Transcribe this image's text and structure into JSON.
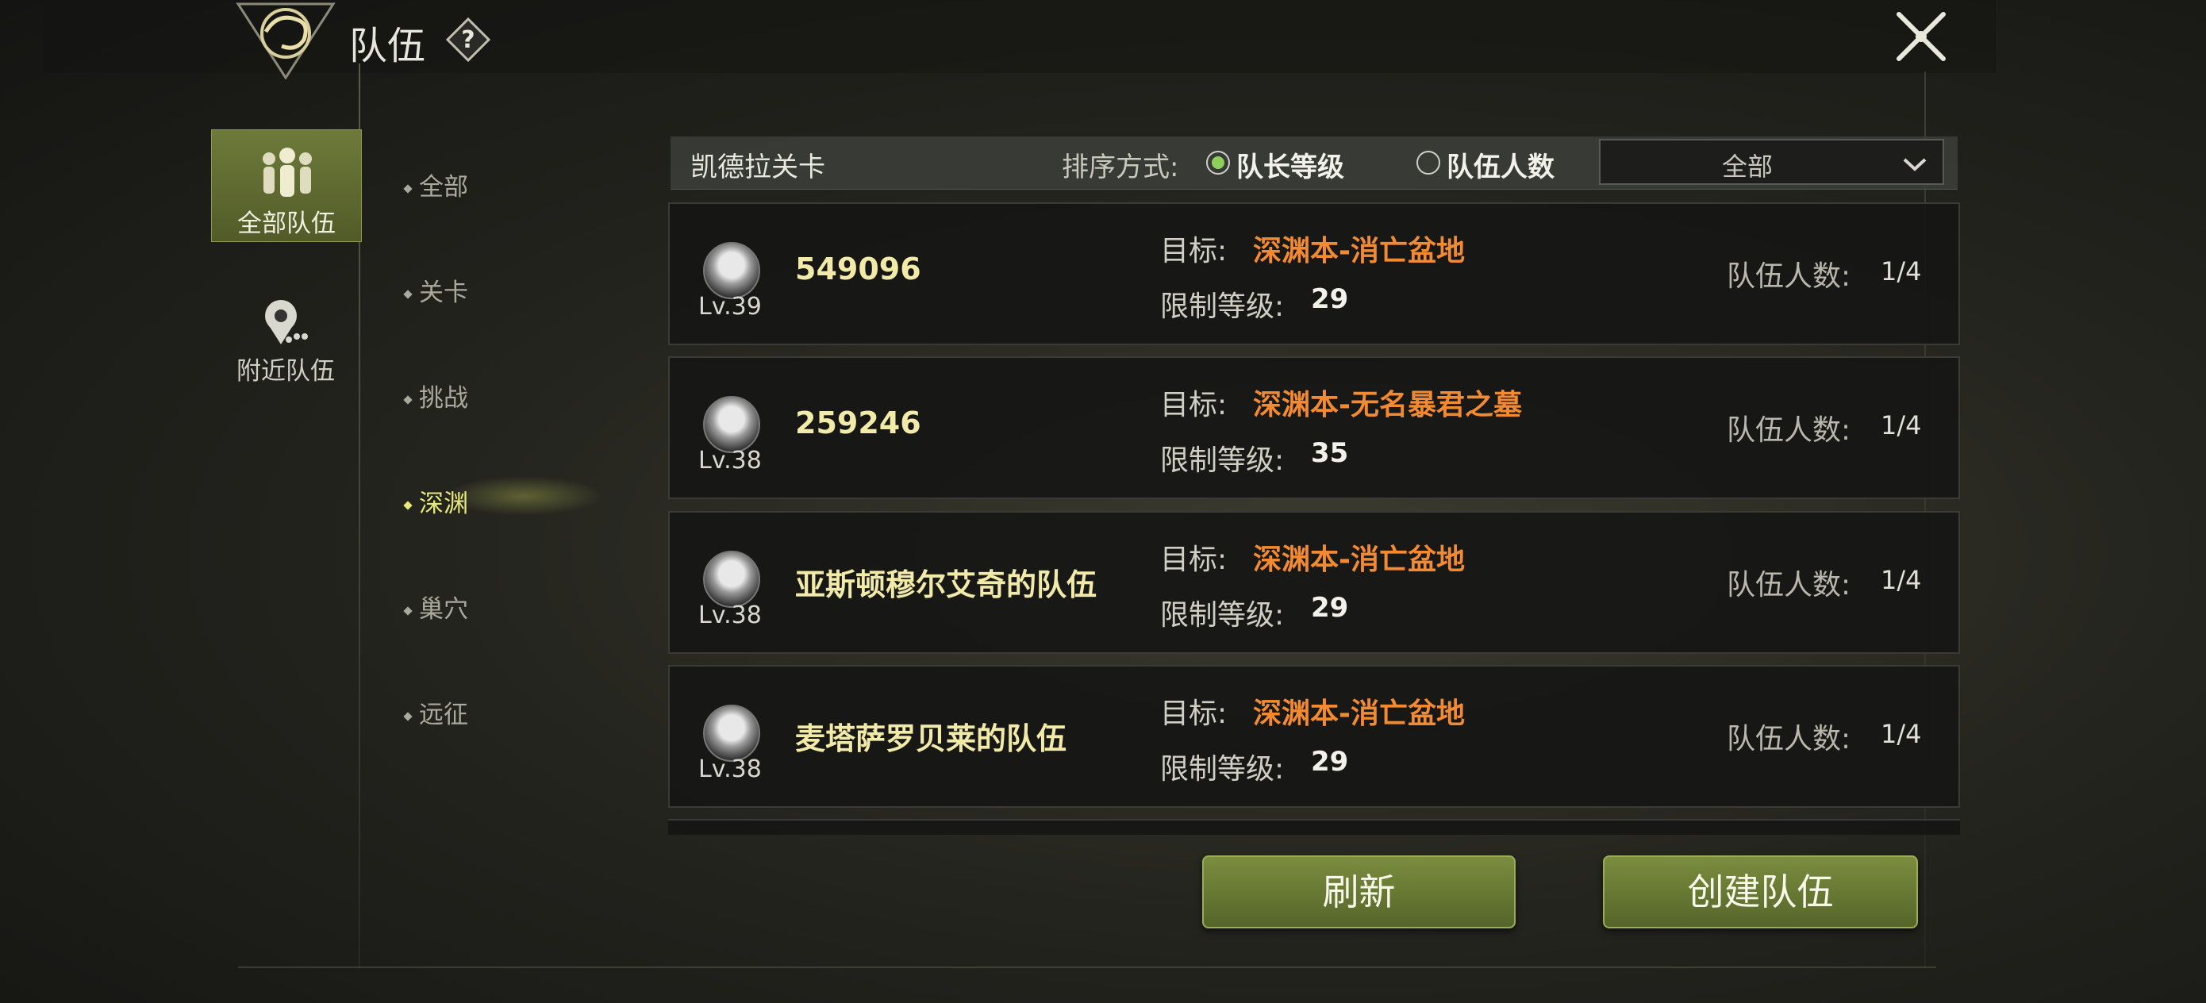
{
  "window": {
    "title": "队伍",
    "help_icon": "question-icon",
    "close_icon": "close-icon"
  },
  "categories": [
    {
      "label": "全部队伍",
      "icon": "group-icon",
      "selected": true
    },
    {
      "label": "附近队伍",
      "icon": "location-people-icon",
      "selected": false
    }
  ],
  "subcategories": [
    {
      "label": "全部",
      "active": false
    },
    {
      "label": "关卡",
      "active": false
    },
    {
      "label": "挑战",
      "active": false
    },
    {
      "label": "深渊",
      "active": true
    },
    {
      "label": "巢穴",
      "active": false
    },
    {
      "label": "远征",
      "active": false
    }
  ],
  "header": {
    "title": "凯德拉关卡",
    "sort_label": "排序方式:",
    "sort_options": [
      {
        "label": "队长等级",
        "selected": true
      },
      {
        "label": "队伍人数",
        "selected": false
      }
    ],
    "filter_value": "全部"
  },
  "teams": [
    {
      "level": "Lv.39",
      "name": "549096",
      "target_label": "目标:",
      "target": "深渊本-消亡盆地",
      "limit_label": "限制等级:",
      "limit": "29",
      "members_label": "队伍人数:",
      "members": "1/4"
    },
    {
      "level": "Lv.38",
      "name": "259246",
      "target_label": "目标:",
      "target": "深渊本-无名暴君之墓",
      "limit_label": "限制等级:",
      "limit": "35",
      "members_label": "队伍人数:",
      "members": "1/4"
    },
    {
      "level": "Lv.38",
      "name": "亚斯顿穆尔艾奇的队伍",
      "target_label": "目标:",
      "target": "深渊本-消亡盆地",
      "limit_label": "限制等级:",
      "limit": "29",
      "members_label": "队伍人数:",
      "members": "1/4"
    },
    {
      "level": "Lv.38",
      "name": "麦塔萨罗贝莱的队伍",
      "target_label": "目标:",
      "target": "深渊本-消亡盆地",
      "limit_label": "限制等级:",
      "limit": "29",
      "members_label": "队伍人数:",
      "members": "1/4"
    }
  ],
  "buttons": {
    "refresh": "刷新",
    "create": "创建队伍"
  },
  "colors": {
    "accent_green": "#6e7a3a",
    "target_orange": "#f28a32",
    "name_yellow": "#f2eaa8",
    "active_sub": "#e8e87a"
  }
}
